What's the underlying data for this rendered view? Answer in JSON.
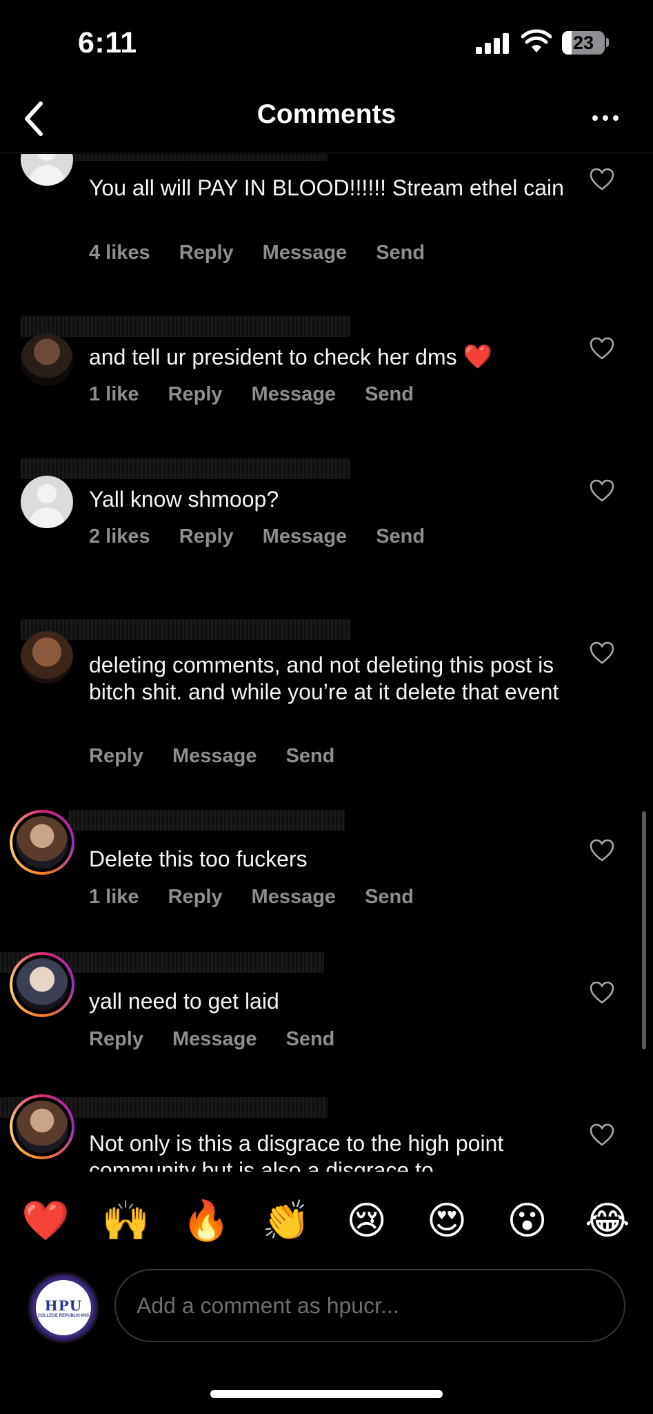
{
  "status_bar": {
    "time": "6:11",
    "battery": "23",
    "battery_level": 0.23
  },
  "header": {
    "title": "Comments"
  },
  "comments": [
    {
      "text": "You all will PAY IN BLOOD!!!!!! Stream ethel cain",
      "likes": "4 likes",
      "reply": "Reply",
      "message": "Message",
      "send": "Send"
    },
    {
      "text": "and tell ur president to check her dms",
      "emoji": "❤️",
      "likes": "1 like",
      "reply": "Reply",
      "message": "Message",
      "send": "Send"
    },
    {
      "text": "Yall know shmoop?",
      "likes": "2 likes",
      "reply": "Reply",
      "message": "Message",
      "send": "Send"
    },
    {
      "text": "deleting comments, and not deleting this post is bitch shit. and while you’re at it delete that event",
      "reply": "Reply",
      "message": "Message",
      "send": "Send"
    },
    {
      "text": "Delete this too fuckers",
      "likes": "1 like",
      "reply": "Reply",
      "message": "Message",
      "send": "Send"
    },
    {
      "text": "yall need to get laid",
      "reply": "Reply",
      "message": "Message",
      "send": "Send"
    },
    {
      "text": "Not only is this a disgrace to the high point community but is also a disgrace to"
    }
  ],
  "emoji_bar": [
    "❤️",
    "🙌",
    "🔥",
    "👏",
    "😢",
    "😍",
    "😮",
    "😂"
  ],
  "composer": {
    "placeholder": "Add a comment as hpucr...",
    "avatar_logo": "HPU",
    "avatar_sub": "COLLEGE REPUBLICANS"
  }
}
